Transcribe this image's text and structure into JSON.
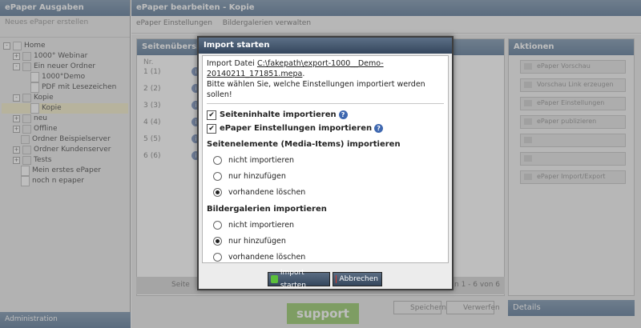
{
  "left": {
    "title": "ePaper Ausgaben",
    "new_button": "Neues ePaper erstellen",
    "tree": [
      {
        "label": "Home",
        "level": 0,
        "type": "home",
        "expander": "-"
      },
      {
        "label": "1000° Webinar",
        "level": 1,
        "type": "folder",
        "expander": "+"
      },
      {
        "label": "Ein neuer Ordner",
        "level": 1,
        "type": "folder",
        "expander": "-"
      },
      {
        "label": "1000°Demo",
        "level": 2,
        "type": "doc",
        "expander": ""
      },
      {
        "label": "PDF mit Lesezeichen",
        "level": 2,
        "type": "doc",
        "expander": ""
      },
      {
        "label": "Kopie",
        "level": 1,
        "type": "folder",
        "expander": "-"
      },
      {
        "label": "Kopie",
        "level": 2,
        "type": "doc",
        "expander": "",
        "selected": true
      },
      {
        "label": "neu",
        "level": 1,
        "type": "folder",
        "expander": "+"
      },
      {
        "label": "Offline",
        "level": 1,
        "type": "folder",
        "expander": "+"
      },
      {
        "label": "Ordner Beispielserver",
        "level": 1,
        "type": "folder",
        "expander": ""
      },
      {
        "label": "Ordner Kundenserver",
        "level": 1,
        "type": "folder",
        "expander": "+"
      },
      {
        "label": "Tests",
        "level": 1,
        "type": "folder",
        "expander": "+"
      },
      {
        "label": "Mein erstes ePaper",
        "level": 1,
        "type": "doc",
        "expander": ""
      },
      {
        "label": "noch n epaper",
        "level": 1,
        "type": "doc",
        "expander": ""
      }
    ],
    "bottom": "Administration"
  },
  "main": {
    "title": "ePaper bearbeiten - Kopie",
    "toolbar": [
      "ePaper Einstellungen",
      "Bildergalerien verwalten"
    ]
  },
  "grid": {
    "title": "Seitenübersicht",
    "col_nr": "Nr.",
    "rows": [
      {
        "nr": "1",
        "sub": "(1)"
      },
      {
        "nr": "2",
        "sub": "(2)"
      },
      {
        "nr": "3",
        "sub": "(3)"
      },
      {
        "nr": "4",
        "sub": "(4)"
      },
      {
        "nr": "5",
        "sub": "(5)"
      },
      {
        "nr": "6",
        "sub": "(6)"
      }
    ],
    "footer_left": "Seite",
    "footer_right": "n 1 - 6 von 6"
  },
  "actions": {
    "title": "Aktionen",
    "items": [
      "ePaper Vorschau",
      "Vorschau Link erzeugen",
      "ePaper Einstellungen",
      "ePaper publizieren",
      "",
      "",
      "ePaper Import/Export"
    ]
  },
  "details": "Details",
  "support": "support",
  "save": "Speichern",
  "discard": "Verwerfen",
  "dialog": {
    "title": "Import starten",
    "file_prefix": "Import Datei",
    "file_line1": "C:\\fakepath\\export-1000__Demo-",
    "file_line2": "20140211_171851.mepa",
    "file_suffix": ".",
    "instruction": "Bitte wählen Sie, welche Einstellungen importiert werden sollen!",
    "check_pages": "Seiteninhalte importieren",
    "check_settings": "ePaper Einstellungen importieren",
    "section_media": "Seitenelemente (Media-Items) importieren",
    "section_gallery": "Bildergalerien importieren",
    "opt_none": "nicht importieren",
    "opt_add": "nur hinzufügen",
    "opt_delete": "vorhandene löschen",
    "btn_start": "Import starten",
    "btn_cancel": "Abbrechen"
  },
  "colors": {
    "accent": "#4b6a8c",
    "dialog_title": "#34465d",
    "support": "#8bc35a"
  }
}
